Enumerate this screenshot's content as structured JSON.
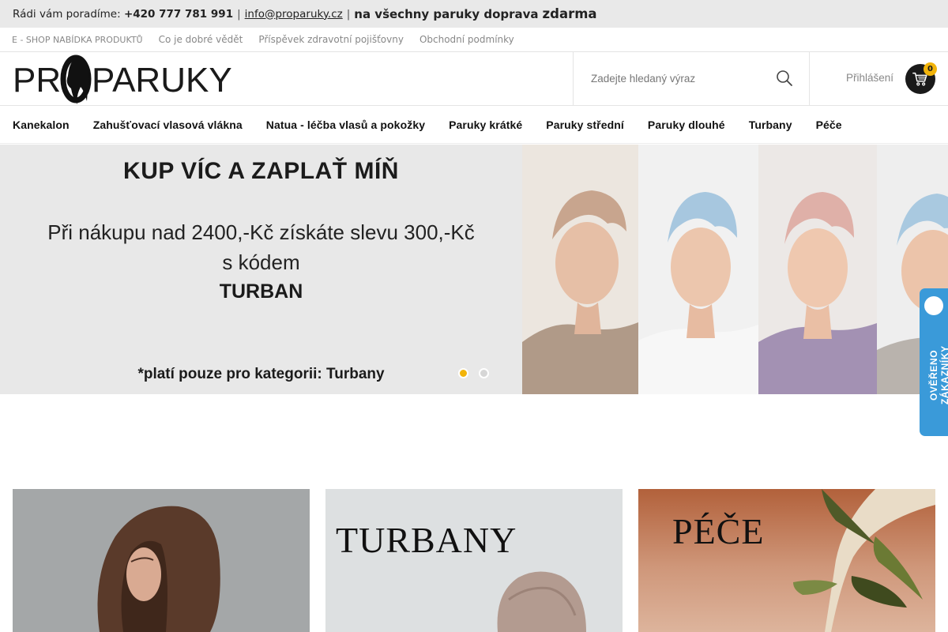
{
  "topbar": {
    "intro": "Rádi vám poradíme:",
    "phone": "+420 777 781 991",
    "sep1": "|",
    "email": "info@proparuky.cz",
    "sep2": "|",
    "promo": "na všechny paruky doprava",
    "promo_strong": "zdarma"
  },
  "submenu": {
    "items": [
      "E - SHOP NABÍDKA PRODUKTŮ",
      "Co je dobré vědět",
      "Příspěvek zdravotní pojišťovny",
      "Obchodní podmínky"
    ]
  },
  "header": {
    "logo_text_left": "PR",
    "logo_text_right": "PARUKY",
    "search_placeholder": "Zadejte hledaný výraz",
    "login_label": "Přihlášení",
    "cart_count": "0"
  },
  "nav": {
    "items": [
      "Kanekalon",
      "Zahušťovací vlasová vlákna",
      "Natua - léčba vlasů a pokožky",
      "Paruky krátké",
      "Paruky střední",
      "Paruky dlouhé",
      "Turbany",
      "Péče"
    ]
  },
  "banner": {
    "headline": "KUP VÍC A ZAPLAŤ MÍŇ",
    "line1": "Při nákupu nad 2400,-Kč získáte slevu 300,-Kč",
    "line2": "s kódem",
    "code": "TURBAN",
    "note": "*platí pouze pro kategorii: Turbany",
    "slides": 2,
    "active_slide": 1
  },
  "verified_badge": {
    "label": "OVĚŘENO ZÁKAZNÍKY"
  },
  "categories": [
    {
      "title": ""
    },
    {
      "title": "TURBANY"
    },
    {
      "title": "PÉČE"
    }
  ],
  "colors": {
    "accent": "#f2b40a",
    "topbar_bg": "#e9e9e9",
    "banner_bg": "#e8e8e8",
    "badge_blue": "#3a9ad9",
    "cart_bg": "#1a1a1a"
  }
}
